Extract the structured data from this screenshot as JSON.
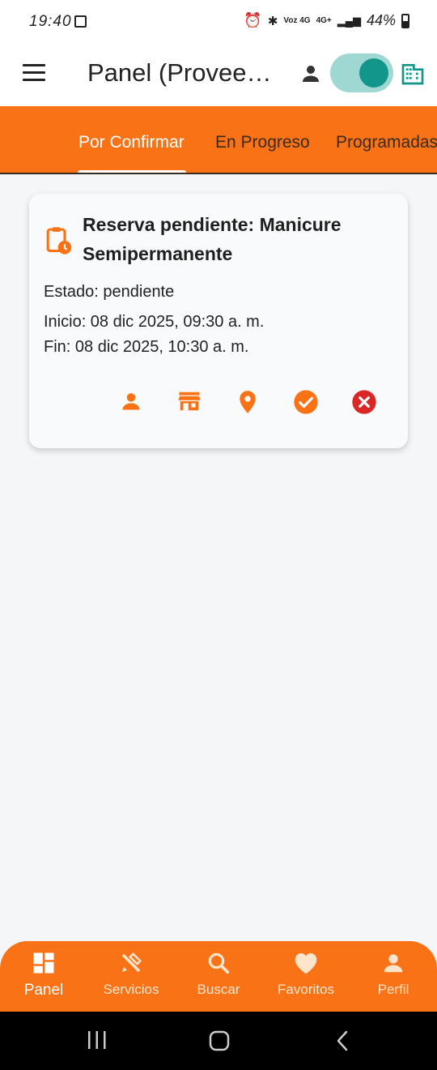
{
  "status_bar": {
    "time": "19:40",
    "network": "4G+",
    "volte": "Voz 4G",
    "battery": "44%"
  },
  "app_bar": {
    "title": "Panel (Proveedor)"
  },
  "tabs": [
    {
      "label": "Por Confirmar",
      "active": true
    },
    {
      "label": "En Progreso",
      "active": false
    },
    {
      "label": "Programadas",
      "active": false
    }
  ],
  "booking_card": {
    "title": "Reserva pendiente: Manicure Semipermanente",
    "status": "Estado: pendiente",
    "start": "Inicio: 08 dic 2025, 09:30 a. m.",
    "end": "Fin: 08 dic 2025, 10:30 a. m.",
    "actions": [
      "person-icon",
      "store-icon",
      "location-pin-icon",
      "check-circle-icon",
      "cancel-circle-icon"
    ]
  },
  "bottom_nav": [
    {
      "label": "Panel",
      "icon": "dashboard-icon",
      "active": true
    },
    {
      "label": "Servicios",
      "icon": "tools-icon",
      "active": false
    },
    {
      "label": "Buscar",
      "icon": "search-icon",
      "active": false
    },
    {
      "label": "Favoritos",
      "icon": "heart-icon",
      "active": false
    },
    {
      "label": "Perfil",
      "icon": "person-icon",
      "active": false
    }
  ],
  "colors": {
    "accent": "#f97316",
    "teal": "#12958a",
    "danger": "#dc2626"
  }
}
